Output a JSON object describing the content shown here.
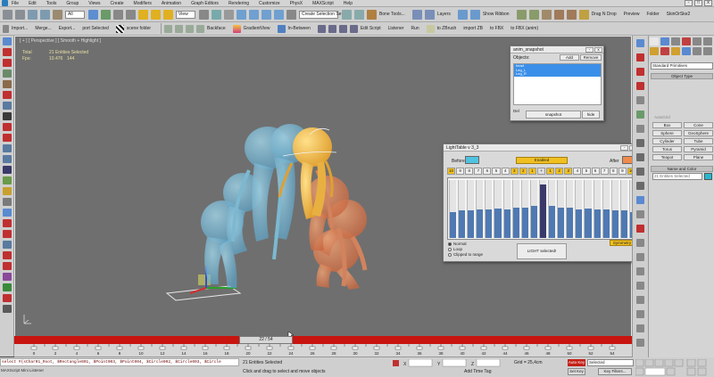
{
  "menubar": {
    "items": [
      "File",
      "Edit",
      "Tools",
      "Group",
      "Views",
      "Create",
      "Modifiers",
      "Animation",
      "Graph Editors",
      "Rendering",
      "Customize",
      "PhysX",
      "MAXScript",
      "Help"
    ],
    "window_controls": [
      "-",
      "□",
      "x"
    ]
  },
  "toolbar1": {
    "selection_filter": "All",
    "view_dropdown": "View",
    "named_selection": "Create Selection Se",
    "bone_tools": "Bone Tools...",
    "layers": "Layers",
    "show_ribbon": "Show Ribbon",
    "drag_n_drop": "Drag N Drop",
    "preview": "Preview",
    "folder": "Folder",
    "skin_or_ske": "SkinOrSke2"
  },
  "toolbar2": {
    "items": [
      "Import...",
      "Merge...",
      "Export...",
      "port Selected",
      "scene folder",
      "Backface",
      "GradientView",
      "In-Between",
      "Edit Script",
      "Listener",
      "Run",
      "to ZBrush",
      "import ZB",
      "to FBX",
      "to FBX (anim)"
    ]
  },
  "viewport": {
    "label": "[ + ] [ Perspective ] [ Smooth + Highlight ]",
    "stats": [
      {
        "label": "Total",
        "value": "21 Entities Selected"
      },
      {
        "label": "Fps:",
        "value": "10.476",
        "extra": "144"
      }
    ]
  },
  "anim_snapshot": {
    "title": "anim_snapshot",
    "objects_label": "Objects:",
    "add": "Add",
    "remove": "Remove",
    "list": [
      "head",
      "Leg_L",
      "Leg_R"
    ],
    "del": "Del",
    "snapshot": "snapshot",
    "hide": "hide"
  },
  "light_table": {
    "title": "LightTable v 3_3",
    "before_label": "Before",
    "enabled": "Enabled",
    "after_label": "After",
    "cells": [
      "10",
      "9",
      "8",
      "7",
      "6",
      "5",
      "4",
      "3",
      "2",
      "1",
      "+",
      "1",
      "2",
      "3",
      "4",
      "5",
      "6",
      "7",
      "8",
      "9",
      "10"
    ],
    "slider_levels": [
      0.45,
      0.47,
      0.47,
      0.49,
      0.5,
      0.51,
      0.5,
      0.52,
      0.53,
      0.55,
      0.92,
      0.55,
      0.53,
      0.52,
      0.5,
      0.51,
      0.5,
      0.49,
      0.47,
      0.47,
      0.45
    ],
    "radios": [
      "Normal",
      "Loop",
      "Clipped to range"
    ],
    "light_button": "LIGHT selected!",
    "symmetry": "Symmetry",
    "colors": {
      "before": "#4fc3e0",
      "after": "#f08a4a",
      "enabled": "#f0c020",
      "slider_fill": "#4f79b2",
      "slider_current": "#3a3a6a"
    }
  },
  "timeline": {
    "slider": "22 / 54",
    "ticks": [
      "0",
      "2",
      "4",
      "6",
      "8",
      "10",
      "12",
      "14",
      "16",
      "18",
      "20",
      "22",
      "24",
      "26",
      "28",
      "30",
      "32",
      "34",
      "36",
      "38",
      "40",
      "42",
      "44",
      "46",
      "48",
      "50",
      "52",
      "54"
    ]
  },
  "status": {
    "maxscript": "select #(sChar01_Root, $Rectangle001, $Point003, $Point004, $Circle002, $Circle003, $Circle",
    "listener_label": "MAXScript Mini Listener",
    "selected": "21 Entities Selected",
    "hint": "Click and drag to select and move objects",
    "grid": "Grid = 25,4cm",
    "add_time_tag": "Add Time Tag",
    "auto_key": "Auto Key",
    "set_key": "Set Key",
    "selected_dd": "Selected",
    "key_filters": "Key Filters..."
  },
  "command_panel": {
    "primitives_dropdown": "Standard Primitives",
    "object_type_header": "Object Type",
    "autogrid": "AutoGrid",
    "objects": [
      "Box",
      "Cone",
      "Sphere",
      "GeoSphere",
      "Cylinder",
      "Tube",
      "Torus",
      "Pyramid",
      "Teapot",
      "Plane"
    ],
    "name_color_header": "Name and Color",
    "name_field": "21 Entities Selected",
    "swatch_color": "#28b8d0"
  }
}
